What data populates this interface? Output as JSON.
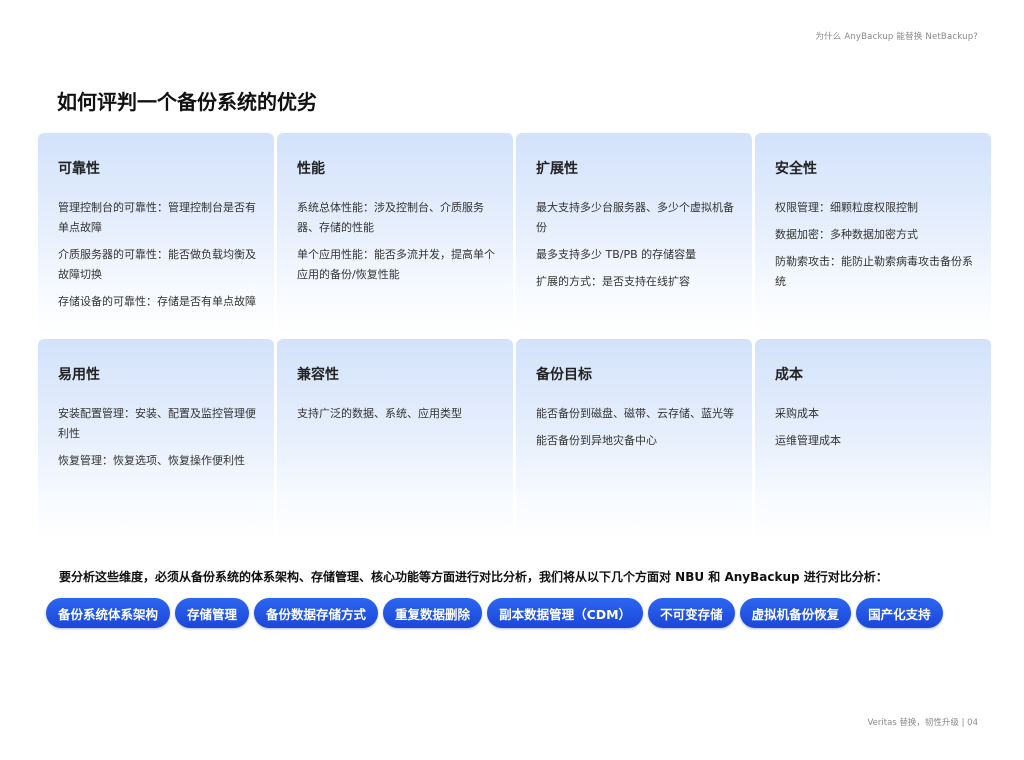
{
  "header_note": "为什么 AnyBackup 能替换 NetBackup?",
  "page_title": "如何评判一个备份系统的优劣",
  "cards": [
    {
      "title": "可靠性",
      "lines": [
        "管理控制台的可靠性：管理控制台是否有单点故障",
        "介质服务器的可靠性：能否做负载均衡及故障切换",
        "存储设备的可靠性：存储是否有单点故障"
      ]
    },
    {
      "title": "性能",
      "lines": [
        "系统总体性能：涉及控制台、介质服务器、存储的性能",
        "单个应用性能：能否多流并发，提高单个应用的备份/恢复性能"
      ]
    },
    {
      "title": "扩展性",
      "lines": [
        "最大支持多少台服务器、多少个虚拟机备份",
        "最多支持多少 TB/PB 的存储容量",
        "扩展的方式：是否支持在线扩容"
      ]
    },
    {
      "title": "安全性",
      "lines": [
        "权限管理：细颗粒度权限控制",
        "数据加密：多种数据加密方式",
        "防勒索攻击：能防止勒索病毒攻击备份系统"
      ]
    },
    {
      "title": "易用性",
      "lines": [
        "安装配置管理：安装、配置及监控管理便利性",
        "恢复管理：恢复选项、恢复操作便利性"
      ]
    },
    {
      "title": "兼容性",
      "lines": [
        "支持广泛的数据、系统、应用类型"
      ]
    },
    {
      "title": "备份目标",
      "lines": [
        "能否备份到磁盘、磁带、云存储、蓝光等",
        "能否备份到异地灾备中心"
      ]
    },
    {
      "title": "成本",
      "lines": [
        "采购成本",
        "运维管理成本"
      ]
    }
  ],
  "summary": "要分析这些维度，必须从备份系统的体系架构、存储管理、核心功能等方面进行对比分析，我们将从以下几个方面对 NBU 和 AnyBackup 进行对比分析：",
  "tags": [
    "备份系统体系架构",
    "存储管理",
    "备份数据存储方式",
    "重复数据删除",
    "副本数据管理（CDM）",
    "不可变存储",
    "虚拟机备份恢复",
    "国产化支持"
  ],
  "footer_note": "Veritas 替换，韧性升级 | 04",
  "colors": {
    "tag_blue": "#1f4fe0",
    "card_blue": "#d3e2fb"
  }
}
